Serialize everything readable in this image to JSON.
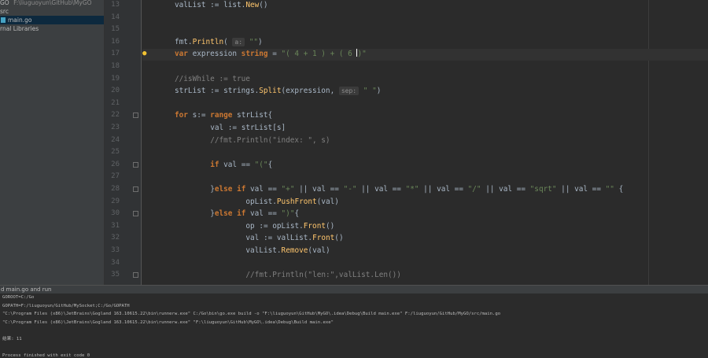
{
  "sidebar": {
    "project_name": "GO",
    "project_path": "F:\\liuguoyun\\GitHub\\MyGO",
    "items": [
      {
        "label": "src"
      },
      {
        "label": "main.go"
      },
      {
        "label": "rnal Libraries"
      }
    ]
  },
  "editor": {
    "lines": [
      {
        "n": "13",
        "code": "valList := list.New()"
      },
      {
        "n": "14",
        "code": ""
      },
      {
        "n": "15",
        "code": ""
      },
      {
        "n": "16",
        "code": "fmt.Println( a: \"\")"
      },
      {
        "n": "17",
        "code": "var expression string = \"( 4 + 1 ) + ( 6 )\""
      },
      {
        "n": "18",
        "code": ""
      },
      {
        "n": "19",
        "code": "//isWhile := true"
      },
      {
        "n": "20",
        "code": "strList := strings.Split(expression, sep: \" \")"
      },
      {
        "n": "21",
        "code": ""
      },
      {
        "n": "22",
        "code": "for s:= range strList{"
      },
      {
        "n": "23",
        "code": "val := strList[s]"
      },
      {
        "n": "24",
        "code": "//fmt.Println(\"index: \", s)"
      },
      {
        "n": "25",
        "code": ""
      },
      {
        "n": "26",
        "code": "if val == \"(\"{"
      },
      {
        "n": "27",
        "code": ""
      },
      {
        "n": "28",
        "code": "}else if val == \"+\" || val == \"-\" || val == \"*\" || val == \"/\" || val == \"sqrt\" || val == \"\" {"
      },
      {
        "n": "29",
        "code": "opList.PushFront(val)"
      },
      {
        "n": "30",
        "code": "}else if val == \")\"{"
      },
      {
        "n": "31",
        "code": "op := opList.Front()"
      },
      {
        "n": "32",
        "code": "val := valList.Front()"
      },
      {
        "n": "33",
        "code": "valList.Remove(val)"
      },
      {
        "n": "34",
        "code": ""
      },
      {
        "n": "35",
        "code": "//fmt.Println(\"len:\",valList.Len())"
      }
    ]
  },
  "run": {
    "title": "d main.go and run",
    "console": [
      "GOROOT=C:/Go",
      "GOPATH=F:/liuguoyun/GitHub/MySocket;C:/Go/GOPATH",
      "\"C:\\Program Files (x86)\\JetBrains\\Gogland 163.10615.22\\bin\\runnerw.exe\" C:/Go\\bin\\go.exe build -o \"F:\\liuguoyun\\GitHub\\MyGO\\.idea\\Debug\\Build main.exe\" F:/liuguoyun/GitHub/MyGO/src/main.go",
      "\"C:\\Program Files (x86)\\JetBrains\\Gogland 163.10615.22\\bin\\runnerw.exe\" \"F:\\liuguoyun\\GitHub\\MyGO\\.idea\\Debug\\Build main.exe\"",
      "",
      "结果: 11",
      "",
      "Process finished with exit code 0"
    ]
  },
  "colors": {
    "background": "#2b2b2b",
    "keyword": "#cc7832",
    "string": "#6a8759",
    "function": "#ffc66d",
    "comment": "#808080",
    "selection": "#0d293e"
  },
  "icons": {
    "file": "go-file-icon",
    "intention": "lightbulb-icon",
    "fold": "fold-marker-icon"
  }
}
